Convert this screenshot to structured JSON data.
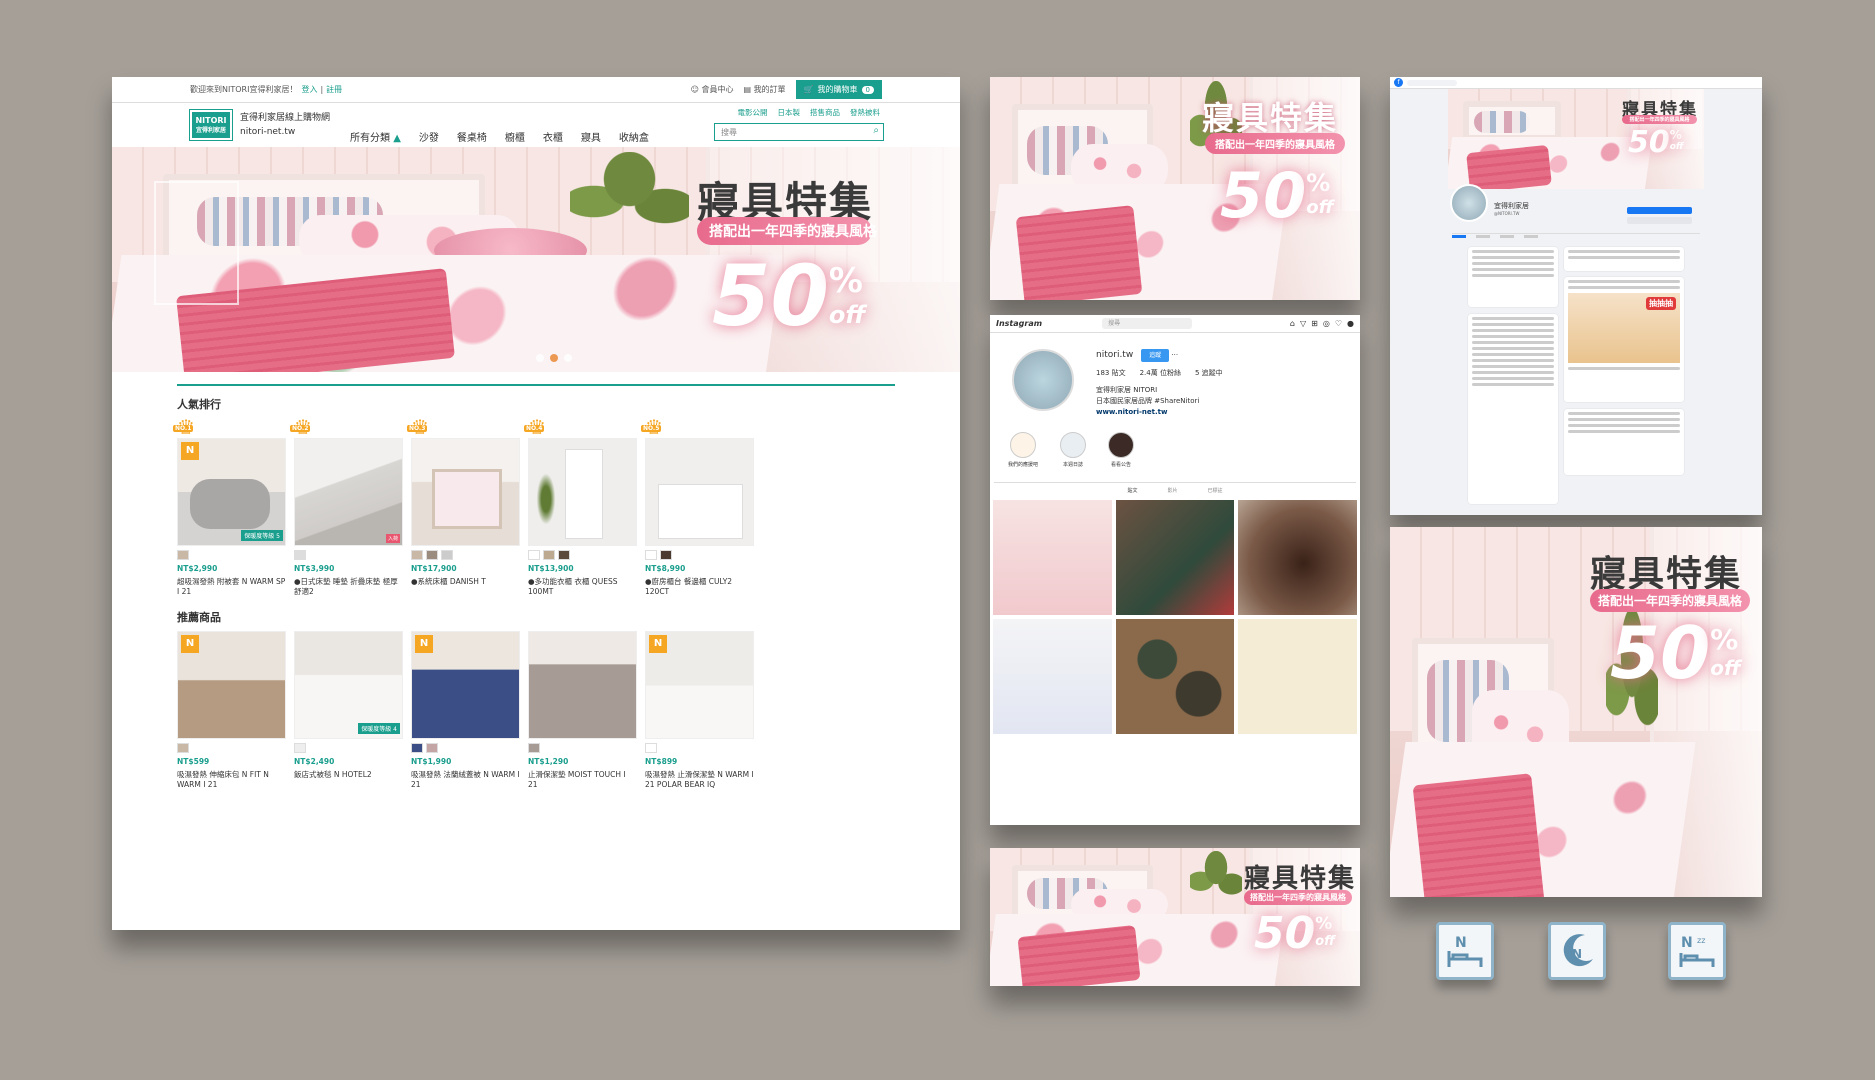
{
  "main_site": {
    "topbar": {
      "welcome": "歡迎來到NITORI宜得利家居！",
      "login": "登入",
      "sep": "|",
      "register": "註冊",
      "member": "會員中心",
      "orders": "我的訂單",
      "cart_label": "我的購物車",
      "cart_count": "0"
    },
    "header": {
      "logo_line1": "NITORI",
      "logo_line2": "宜得利家居",
      "site_name": "宜得利家居線上購物網",
      "site_url": "nitori-net.tw",
      "links": [
        "電影公開",
        "日本製",
        "搭售商品",
        "發熱被料"
      ],
      "search_placeholder": "搜尋",
      "nav": [
        "所有分類",
        "沙發",
        "餐桌椅",
        "櫥櫃",
        "衣櫃",
        "寢具",
        "收納盒"
      ]
    },
    "hero": {
      "title": "寢具特集",
      "subtitle": "搭配出一年四季的寢具風格",
      "num": "50",
      "pct": "%",
      "off": "off"
    },
    "ranking": {
      "title": "人氣排行",
      "items": [
        {
          "rank": "NO.1",
          "price": "NT$2,990",
          "name": "超吸濕發熱 附被套 N WARM SP I 21",
          "badge": "保暖度等級 5"
        },
        {
          "rank": "NO.2",
          "price": "NT$3,990",
          "name": "●日式床墊 睡墊 折疊床墊 極厚舒適2",
          "badge": "入荷"
        },
        {
          "rank": "NO.3",
          "price": "NT$17,900",
          "name": "●系統床櫃 DANISH T",
          "badge": ""
        },
        {
          "rank": "NO.4",
          "price": "NT$13,900",
          "name": "●多功能衣櫃 衣櫃 QUESS 100MT",
          "badge": ""
        },
        {
          "rank": "NO.5",
          "price": "NT$8,990",
          "name": "●廚房櫃台 餐邊櫃 CULY2 120CT",
          "badge": ""
        }
      ]
    },
    "recommend": {
      "title": "推薦商品",
      "items": [
        {
          "price": "NT$599",
          "name": "吸濕發熱 伸縮床包 N FIT N WARM I 21"
        },
        {
          "price": "NT$2,490",
          "name": "飯店式被毯 N HOTEL2",
          "badge": "保暖度等級 4"
        },
        {
          "price": "NT$1,990",
          "name": "吸濕發熱 法蘭絨蓋被 N WARM I 21"
        },
        {
          "price": "NT$1,290",
          "name": "止滑保潔墊 MOIST TOUCH I 21"
        },
        {
          "price": "NT$899",
          "name": "吸濕發熱 止滑保潔墊 N WARM I 21 POLAR BEAR IQ"
        }
      ]
    }
  },
  "banner": {
    "title": "寢具特集",
    "subtitle": "搭配出一年四季的寢具風格",
    "num": "50",
    "pct": "%",
    "off": "off"
  },
  "instagram": {
    "logo": "Instagram",
    "search": "搜尋",
    "username": "nitori.tw",
    "follow": "追蹤",
    "stats": [
      "183 貼文",
      "2.4萬 位粉絲",
      "5 追蹤中"
    ],
    "display_name": "宜得利家居 NITORI",
    "bio": "日本國民家居品牌 #ShareNitori",
    "link": "www.nitori-net.tw",
    "highlights": [
      "我們的應援吧",
      "本週日誌",
      "看看公告"
    ],
    "tabs": [
      "貼文",
      "影片",
      "已標註"
    ]
  },
  "facebook": {
    "page_name": "宜得利家居",
    "page_handle": "@NITORI.TW",
    "post_title": "抽抽抽"
  },
  "colors": {
    "brand_teal": "#1a9e8d",
    "pink": "#e86a8c",
    "crown": "#f5a623"
  }
}
